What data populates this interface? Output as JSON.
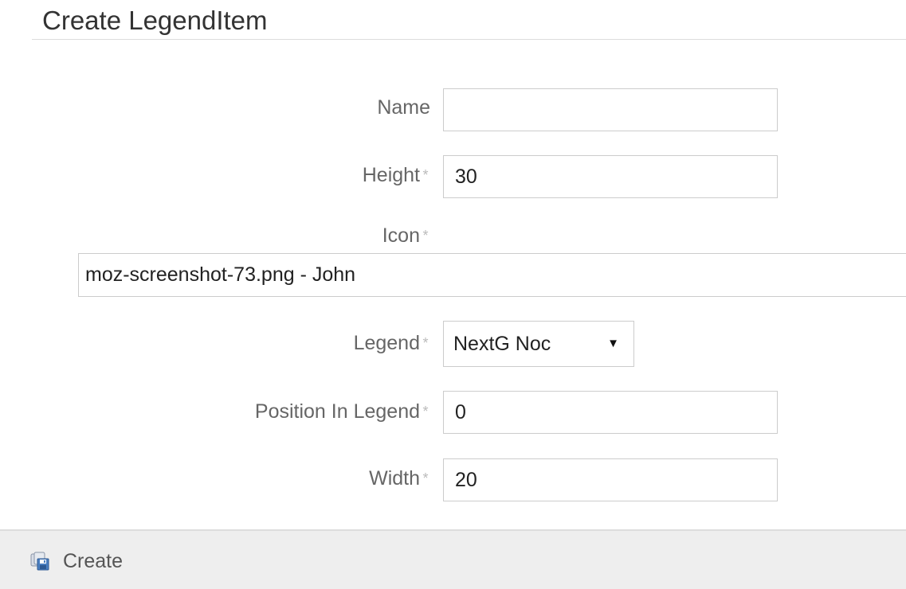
{
  "page": {
    "title": "Create LegendItem"
  },
  "form": {
    "name": {
      "label": "Name",
      "value": ""
    },
    "height": {
      "label": "Height",
      "required_mark": "*",
      "value": "30"
    },
    "icon": {
      "label": "Icon",
      "required_mark": "*",
      "selected": "moz-screenshot-73.png - John"
    },
    "legend": {
      "label": "Legend",
      "required_mark": "*",
      "selected": "NextG Noc",
      "caret": "▼"
    },
    "position_in_legend": {
      "label": "Position In Legend",
      "required_mark": "*",
      "value": "0"
    },
    "width": {
      "label": "Width",
      "required_mark": "*",
      "value": "20"
    }
  },
  "footer": {
    "create_label": "Create",
    "create_icon": "save-icon"
  }
}
